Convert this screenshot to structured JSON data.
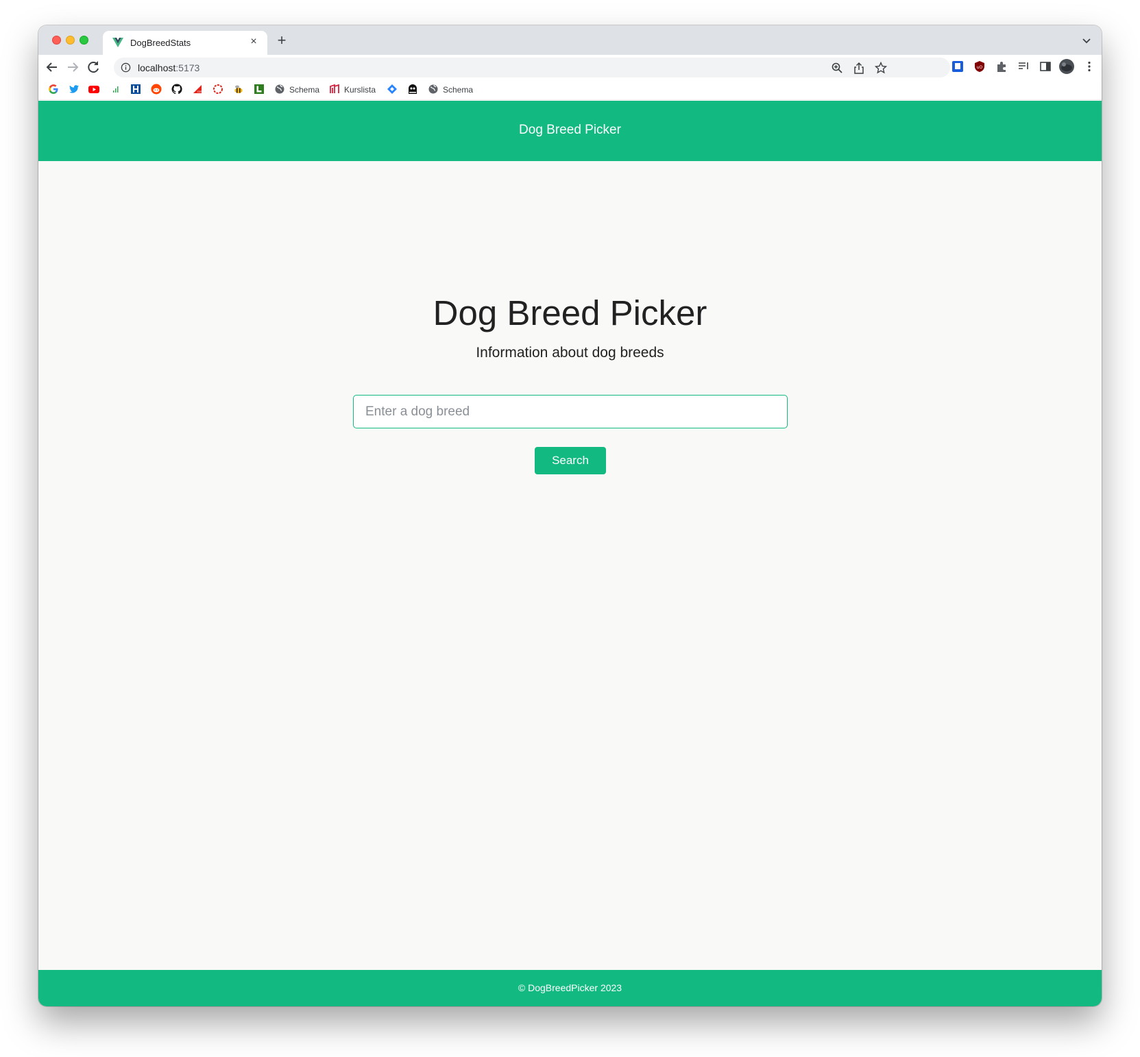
{
  "browser": {
    "tab": {
      "title": "DogBreedStats",
      "close_glyph": "×"
    },
    "new_tab_glyph": "+",
    "url": {
      "host": "localhost",
      "port": ":5173"
    },
    "bookmarks": [
      {
        "icon": "google-icon"
      },
      {
        "icon": "twitter-icon"
      },
      {
        "icon": "youtube-icon"
      },
      {
        "icon": "analytics-icon"
      },
      {
        "icon": "bookmark-h-icon"
      },
      {
        "icon": "reddit-icon"
      },
      {
        "icon": "github-icon"
      },
      {
        "icon": "csn-icon"
      },
      {
        "icon": "ring-icon"
      },
      {
        "icon": "bee-icon"
      },
      {
        "icon": "l-icon"
      },
      {
        "icon": "globe-icon",
        "label": "Schema"
      },
      {
        "icon": "kurslista-icon",
        "label": "Kurslista"
      },
      {
        "icon": "diamond-icon"
      },
      {
        "icon": "ghost-icon"
      },
      {
        "icon": "globe-icon",
        "label": "Schema"
      }
    ]
  },
  "site": {
    "header_title": "Dog Breed Picker",
    "hero": {
      "title": "Dog Breed Picker",
      "subtitle": "Information about dog breeds"
    },
    "search": {
      "placeholder": "Enter a dog breed",
      "value": "",
      "button_label": "Search"
    },
    "footer": "© DogBreedPicker 2023"
  },
  "colors": {
    "accent": "#12b981",
    "page_bg": "#f9f9f8",
    "text": "#222222"
  }
}
